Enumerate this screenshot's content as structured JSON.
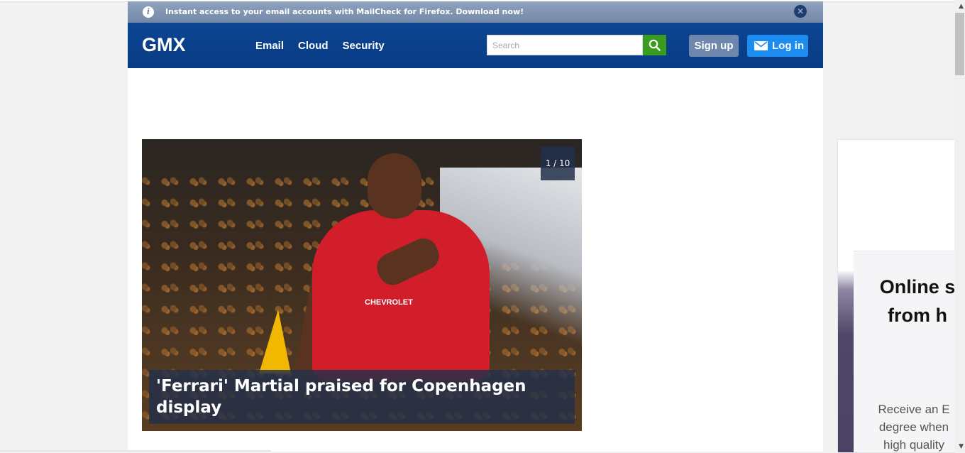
{
  "infobar": {
    "message": "Instant access to your email accounts with MailCheck for Firefox. Download now!",
    "info_icon": "info-icon",
    "close_icon": "close-icon"
  },
  "header": {
    "logo": "GMX",
    "nav": [
      "Email",
      "Cloud",
      "Security"
    ],
    "search_placeholder": "Search",
    "signup_label": "Sign up",
    "login_label": "Log in"
  },
  "hero": {
    "counter": "1 / 10",
    "headline": "'Ferrari' Martial praised for Copenhagen display",
    "shirt_sponsor": "CHEVROLET"
  },
  "ad": {
    "title_line1": "Online s",
    "title_line2": "from h",
    "body_line1": "Receive an E",
    "body_line2": "degree when",
    "body_line3": "high quality"
  },
  "colors": {
    "nav_blue": "#0a418c",
    "infobar": "#8196b5",
    "search_green": "#3a9b21",
    "login_blue": "#1c8cf0",
    "signup_gray": "#6f87ad"
  }
}
